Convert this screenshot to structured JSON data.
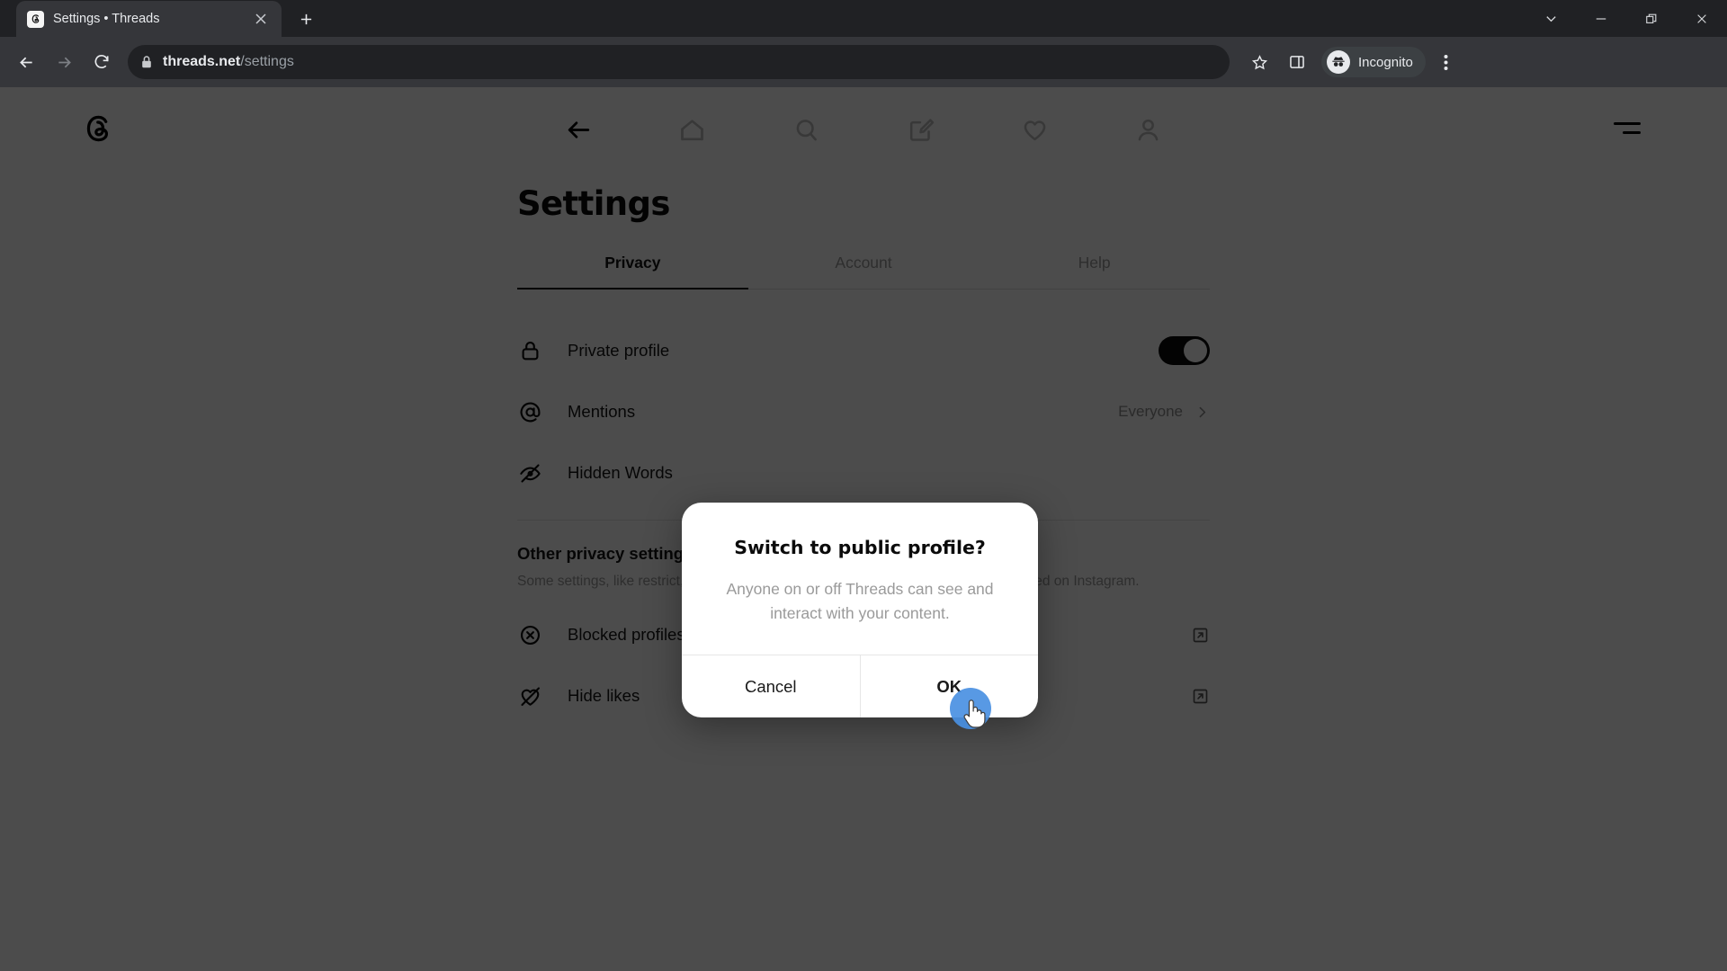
{
  "browser": {
    "tab": {
      "title": "Settings • Threads",
      "favicon_icon": "threads-favicon",
      "close_icon": "close-icon"
    },
    "new_tab_label": "+",
    "window_controls": [
      {
        "name": "chevron-down-button",
        "icon": "chevron-down-icon"
      },
      {
        "name": "minimize-button",
        "icon": "minimize-icon"
      },
      {
        "name": "restore-button",
        "icon": "restore-icon"
      },
      {
        "name": "close-window-button",
        "icon": "close-icon"
      }
    ],
    "toolbar": {
      "back_icon": "back-arrow-icon",
      "forward_icon": "forward-arrow-icon",
      "reload_icon": "reload-icon",
      "lock_icon": "lock-icon",
      "url_host": "threads.net",
      "url_path": "/settings",
      "bookmark_icon": "star-icon",
      "side_panel_icon": "side-panel-icon",
      "profile_label": "Incognito",
      "profile_icon": "incognito-avatar-icon",
      "menu_icon": "three-dot-menu-icon"
    }
  },
  "app": {
    "logo_icon": "threads-logo-icon",
    "menu_icon": "hamburger-menu-icon",
    "nav": [
      {
        "name": "nav-back",
        "icon": "back-arrow-icon",
        "active": true
      },
      {
        "name": "nav-home",
        "icon": "home-icon",
        "active": false
      },
      {
        "name": "nav-search",
        "icon": "search-icon",
        "active": false
      },
      {
        "name": "nav-compose",
        "icon": "compose-icon",
        "active": false
      },
      {
        "name": "nav-activity",
        "icon": "heart-icon",
        "active": false
      },
      {
        "name": "nav-profile",
        "icon": "person-icon",
        "active": false
      }
    ],
    "page_title": "Settings",
    "tabs": [
      {
        "label": "Privacy",
        "active": true
      },
      {
        "label": "Account",
        "active": false
      },
      {
        "label": "Help",
        "active": false
      }
    ],
    "settings_rows": [
      {
        "icon": "lock-icon",
        "label": "Private profile",
        "control": "toggle",
        "toggle_on": true
      },
      {
        "icon": "at-sign-icon",
        "label": "Mentions",
        "control": "value",
        "value": "Everyone",
        "chevron": "chevron-right-icon"
      },
      {
        "icon": "eye-off-icon",
        "label": "Hidden Words",
        "control": "none",
        "value": ""
      }
    ],
    "other_section": {
      "title": "Other privacy settings",
      "subtitle": "Some settings, like restrict, apply to both Threads and Instagram and can be managed on Instagram.",
      "rows": [
        {
          "icon": "blocked-circle-x-icon",
          "label": "Blocked profiles",
          "action_icon": "external-link-icon"
        },
        {
          "icon": "heart-off-icon",
          "label": "Hide likes",
          "action_icon": "external-link-icon"
        }
      ]
    }
  },
  "dialog": {
    "title": "Switch to public profile?",
    "body": "Anyone on or off Threads can see and interact with your content.",
    "cancel_label": "Cancel",
    "ok_label": "OK"
  },
  "colors": {
    "accent_click": "#4a90e2",
    "chrome_bg": "#202124",
    "toolbar_bg": "#35363a",
    "overlay": "rgba(0,0,0,0.70)"
  }
}
